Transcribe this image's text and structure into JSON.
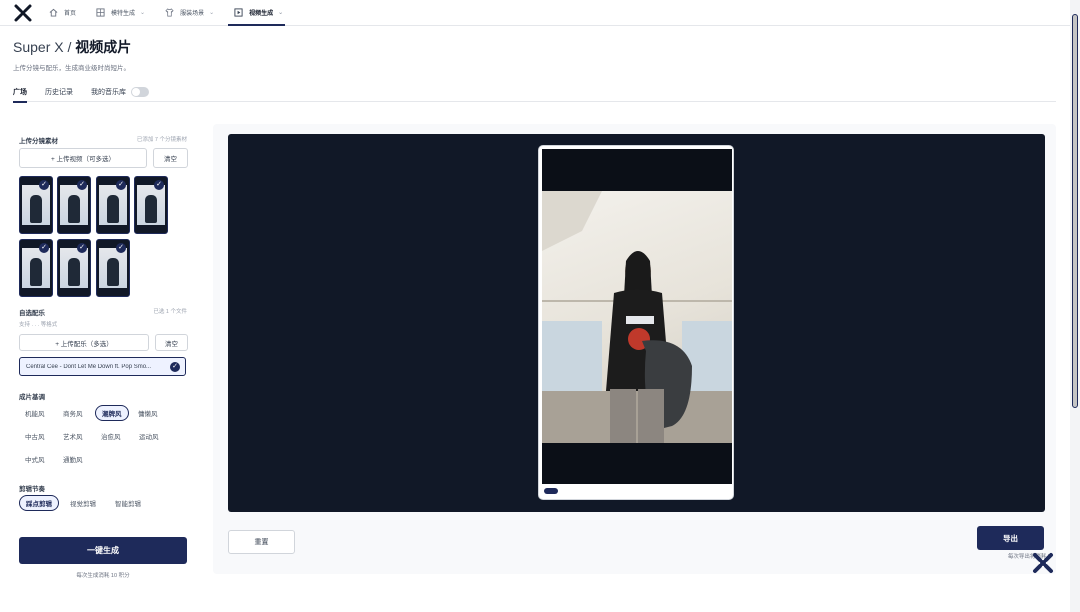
{
  "nav": {
    "tabs": [
      {
        "label": "首页",
        "icon": "home-icon",
        "has_chevron": false
      },
      {
        "label": "模特生成",
        "icon": "grid-icon",
        "has_chevron": true
      },
      {
        "label": "服装场景",
        "icon": "shirt-icon",
        "has_chevron": true
      },
      {
        "label": "视频生成",
        "icon": "play-icon",
        "has_chevron": true,
        "active": true
      }
    ]
  },
  "header": {
    "title_prefix": "Super X /",
    "title_main": "视频成片",
    "subtitle": "上传分镜与配乐，生成商业级时尚短片。"
  },
  "tabs": {
    "square": "广场",
    "history": "历史记录",
    "my_music": "我的音乐库"
  },
  "upload": {
    "title": "上传分镜素材",
    "note": "已添加 7 个分镜素材",
    "upload_button": "+ 上传视频（可多选）",
    "clear_button": "清空",
    "clip_count": 7
  },
  "music": {
    "title": "自选配乐",
    "note": "已选 1 个文件",
    "formats": "支持 . . . 等格式",
    "upload_button": "+ 上传配乐（多选）",
    "clear_button": "清空",
    "selected_track": "Central Cee - Dont Let Me Down ft. Pop Smo..."
  },
  "style": {
    "title": "成片基调",
    "options": [
      "机能风",
      "商务风",
      "潮牌风",
      "慵懒风",
      "中古风",
      "艺术风",
      "治愈风",
      "运动风",
      "中式风",
      "通勤风"
    ],
    "selected": "潮牌风"
  },
  "rhythm": {
    "title": "剪辑节奏",
    "options": [
      "踩点剪辑",
      "视觉剪辑",
      "智能剪辑"
    ],
    "selected": "踩点剪辑"
  },
  "generate": {
    "button": "一键生成",
    "note": "每次生成消耗 10 积分"
  },
  "preview": {
    "reset_button": "重置",
    "export_button": "导出",
    "export_note": "每次导出将消耗 5"
  },
  "colors": {
    "accent": "#1e2a5a",
    "preview_bg": "#111827"
  }
}
